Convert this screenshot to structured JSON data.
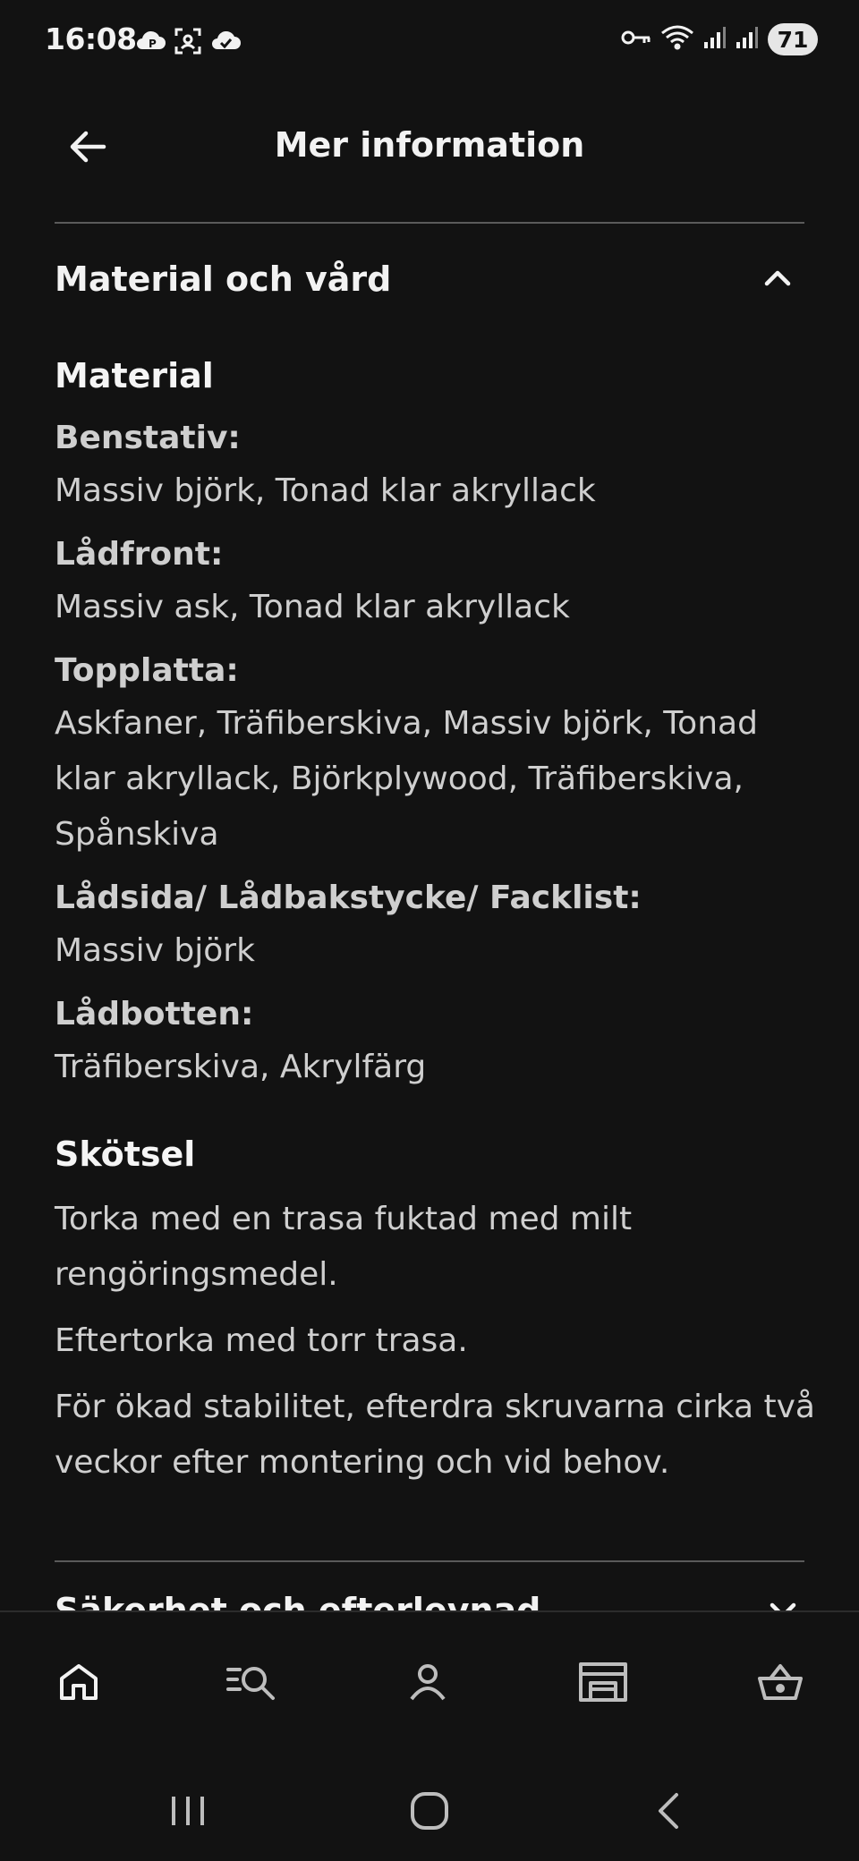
{
  "status_bar": {
    "time": "16:08",
    "battery": "71",
    "left_icons": [
      "cloud-p-icon",
      "scan-icon",
      "cloud-check-icon"
    ],
    "right_icons": [
      "vpn-key-icon",
      "wifi-icon",
      "signal-icon",
      "signal-icon"
    ]
  },
  "header": {
    "title": "Mer information",
    "back_icon": "arrow-left-icon"
  },
  "section": {
    "title": "Material och vård",
    "expanded": true,
    "material": {
      "heading": "Material",
      "items": [
        {
          "label": "Benstativ:",
          "value": "Massiv björk, Tonad klar akryllack"
        },
        {
          "label": "Lådfront:",
          "value": "Massiv ask, Tonad klar akryllack"
        },
        {
          "label": "Topplatta:",
          "value": "Askfaner, Träfiberskiva, Massiv björk, Tonad klar akryllack, Björkplywood, Träfiberskiva, Spånskiva"
        },
        {
          "label": "Lådsida/ Lådbakstycke/ Facklist:",
          "value": "Massiv björk"
        },
        {
          "label": "Lådbotten:",
          "value": "Träfiberskiva, Akrylfärg"
        }
      ]
    },
    "care": {
      "heading": "Skötsel",
      "paragraphs": [
        "Torka med en trasa fuktad med milt rengöringsmedel.",
        "Eftertorka med torr trasa.",
        "För ökad stabilitet, efterdra skruvarna cirka två veckor efter montering och vid behov."
      ]
    }
  },
  "next_section": {
    "title": "Säkerhet och efterlevnad"
  },
  "bottom_nav": {
    "items": [
      "home-icon",
      "search-icon",
      "profile-icon",
      "store-icon",
      "basket-icon"
    ]
  },
  "system_nav": {
    "items": [
      "recents-icon",
      "home-circle-icon",
      "back-chevron-icon"
    ]
  },
  "colors": {
    "background": "#121212",
    "text": "#cfcfcf",
    "heading": "#f2f2f2",
    "divider": "#5a5a5a"
  }
}
